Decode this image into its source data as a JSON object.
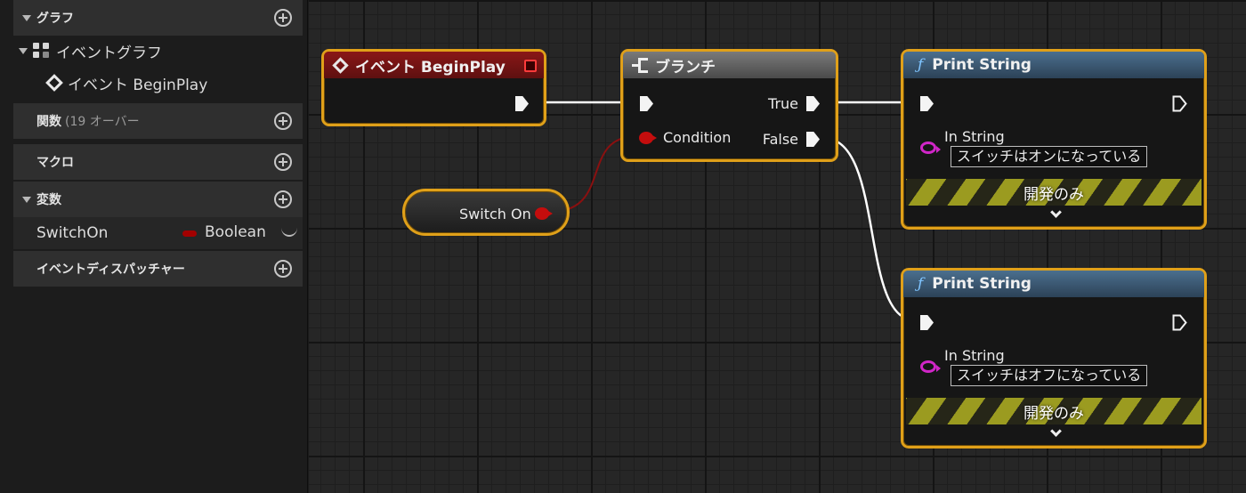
{
  "panel": {
    "graph_section": "グラフ",
    "event_graph": "イベントグラフ",
    "event_beginplay": "イベント BeginPlay",
    "functions_label": "関数",
    "functions_sub": "(19 オーバー",
    "macros_label": "マクロ",
    "variables_label": "変数",
    "variables": [
      {
        "name": "SwitchOn",
        "type": "Boolean",
        "type_color": "#a30000"
      }
    ],
    "dispatchers_label": "イベントディスパッチャー"
  },
  "nodes": {
    "begin_play": {
      "title": "イベント BeginPlay",
      "header_color": "#8a1717"
    },
    "branch": {
      "title": "ブランチ",
      "condition": "Condition",
      "true_label": "True",
      "false_label": "False",
      "header_color": "#7a7a7a"
    },
    "switch_on": {
      "label": "Switch On"
    },
    "print1": {
      "title": "Print String",
      "in_string_label": "In String",
      "in_string_value": "スイッチはオンになっている",
      "dev_only": "開発のみ",
      "header_color": "#4b6f8e"
    },
    "print2": {
      "title": "Print String",
      "in_string_label": "In String",
      "in_string_value": "スイッチはオフになっている",
      "dev_only": "開発のみ",
      "header_color": "#4b6f8e"
    }
  },
  "colors": {
    "node_selected_border": "#e0a019",
    "bool_pin": "#c40d0d",
    "string_pin": "#d126c8",
    "exec_wire": "#ffffff"
  }
}
